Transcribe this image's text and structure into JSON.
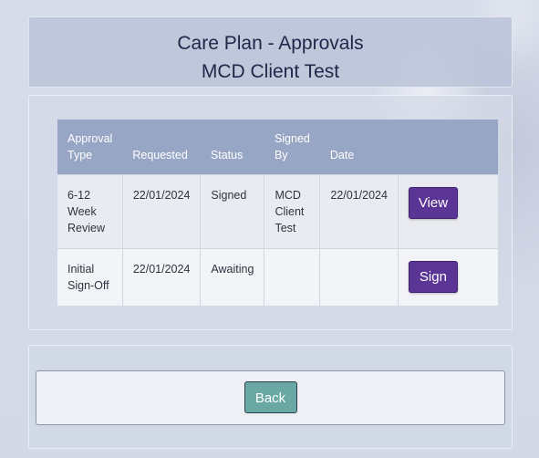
{
  "header": {
    "title_line1": "Care Plan - Approvals",
    "title_line2": "MCD Client Test"
  },
  "table": {
    "columns": [
      "Approval Type",
      "Requested",
      "Status",
      "Signed By",
      "Date",
      ""
    ],
    "rows": [
      {
        "approval_type": "6-12 Week Review",
        "requested": "22/01/2024",
        "status": "Signed",
        "signed_by": "MCD Client Test",
        "date": "22/01/2024",
        "action": "View"
      },
      {
        "approval_type": "Initial Sign-Off",
        "requested": "22/01/2024",
        "status": "Awaiting",
        "signed_by": "",
        "date": "",
        "action": "Sign"
      }
    ]
  },
  "footer": {
    "back_label": "Back"
  },
  "colors": {
    "action_button": "#5a3596",
    "back_button": "#6aa9a3",
    "table_header": "#97a6c4"
  }
}
